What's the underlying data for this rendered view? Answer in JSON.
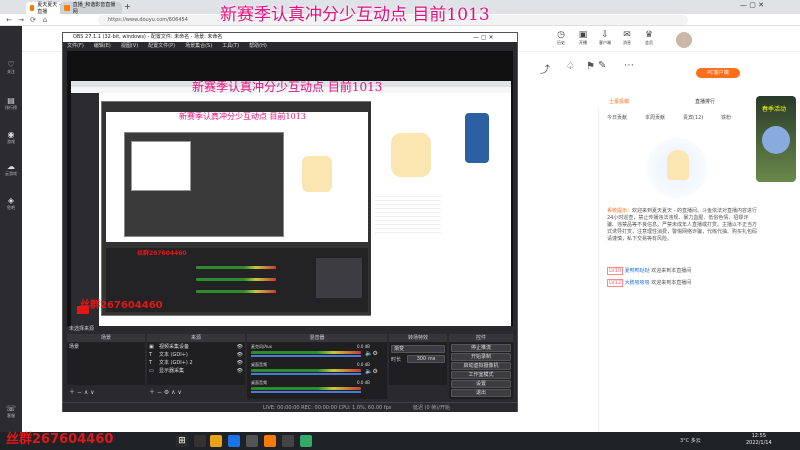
{
  "overlay_title": "新赛季认真冲分少互动点 目前1013",
  "watermark": "丝群267604460",
  "browser": {
    "tabs": [
      {
        "label": "夏天夏天 - 直播"
      },
      {
        "label": "直播_和谐影音直播网"
      }
    ],
    "new_tab": "+",
    "url": "https://www.douyu.com/606454"
  },
  "sidebar": {
    "items": [
      "关注",
      "排行榜",
      "游戏",
      "云游戏",
      "鱼吧",
      "客服"
    ]
  },
  "header_icons": [
    {
      "label": "历史"
    },
    {
      "label": "开播"
    },
    {
      "label": "客户端"
    },
    {
      "label": "消息"
    },
    {
      "label": "会员"
    }
  ],
  "obs": {
    "title": "OBS 27.1.1 (32-bit, windows) - 配置文件: 未命名 - 场景: 未命名",
    "menu": [
      "文件(F)",
      "编辑(E)",
      "视图(V)",
      "配置文件(P)",
      "场景集合(S)",
      "工具(T)",
      "帮助(H)"
    ],
    "docks": {
      "scenes": "场景",
      "sources": "来源",
      "mixer": "混音器",
      "transitions": "转场特效",
      "controls": "控件"
    },
    "scene_list": [
      "场景"
    ],
    "source_list": [
      "视频采集设备",
      "文本 (GDI+)",
      "文本 (GDI+) 2",
      "显示器采集"
    ],
    "mixer_tracks": [
      {
        "name": "麦克风/Aux",
        "db": "0.0 dB"
      },
      {
        "name": "桌面音频",
        "db": "0.0 dB"
      },
      {
        "name": "桌面音频",
        "db": "0.0 dB"
      }
    ],
    "transition": {
      "type": "渐变",
      "duration_label": "时长",
      "duration": "300 ms"
    },
    "controls": [
      "停止推流",
      "开始录制",
      "启动虚拟摄像机",
      "工作室模式",
      "设置",
      "退出"
    ],
    "status": "LIVE: 00:00:00   REC: 00:00:00   CPU: 1.0%, 60.00 fps",
    "status_extra": "延迟 (0 帧)/开始"
  },
  "page_labels": {
    "no_scene_prompt": "未选择来源"
  },
  "douyu_header_right": [
    {
      "label": "分享"
    },
    {
      "label": "PC客户端"
    }
  ],
  "right_panel": {
    "tabs": [
      "今日贡献",
      "本周贡献",
      "贵宾(12)",
      "铁粉"
    ],
    "top_tabs": [
      "土豪投稿",
      "直播排行"
    ],
    "system_notice_label": "系统提示：",
    "system_notice": "欢迎来到夏天夏天 - 的直播间。斗鱼依法对直播内容进行24小时巡查，禁止传播违法违规、暴力血腥、低俗色情、招嫖诈骗、违禁品等不良信息，严禁未成年人直播或打赏。主播以不正当方式诱导打赏，注意理性消费，警惕网络诈骗，代练代抽、购买礼包码请谨慎，私下交易等有风险。",
    "chat": [
      {
        "badge": "LV10",
        "user": "夏鸭鸭哒哒",
        "text": "欢迎来到本直播间"
      },
      {
        "badge": "LV12",
        "user": "大鹏吸吸吸",
        "text": "欢迎来到本直播间"
      }
    ],
    "promo": "春季活动"
  },
  "taskbar": {
    "time": "12:55",
    "date": "2022/1/14",
    "weather": "3°C 多云"
  }
}
